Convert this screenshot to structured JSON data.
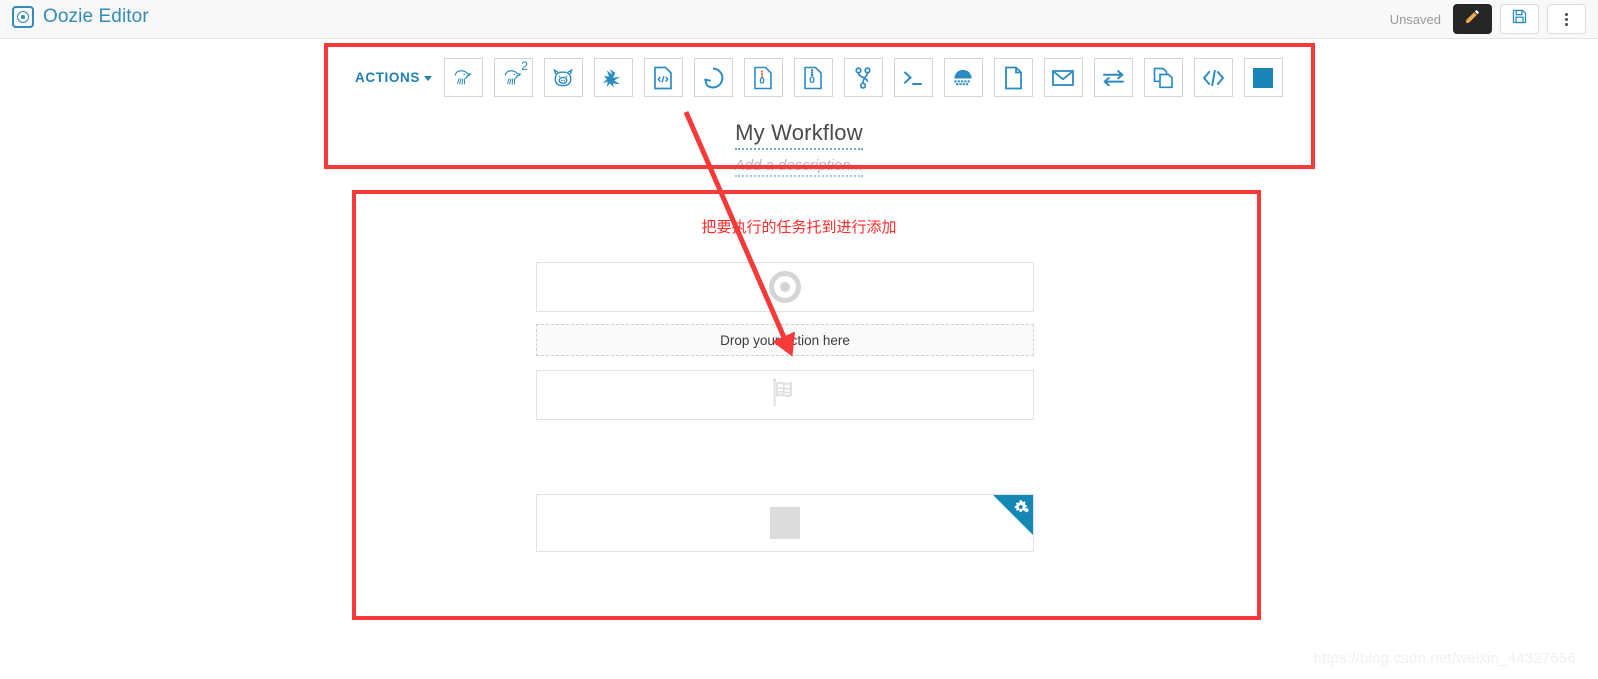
{
  "window": {
    "brand_icon": "oozie-circle-icon",
    "title": "Oozie Editor"
  },
  "topbar": {
    "status_label": "Unsaved",
    "edit_icon": "pencil-icon",
    "save_icon": "floppy-disk-icon",
    "more_icon": "vertical-ellipsis-icon"
  },
  "toolbar": {
    "dropdown_label": "ACTIONS",
    "actions": [
      {
        "name": "hive-action",
        "icon": "hive-elephant-icon",
        "badge": ""
      },
      {
        "name": "hive2-action",
        "icon": "hive-elephant-icon",
        "badge": "2"
      },
      {
        "name": "pig-action",
        "icon": "pig-icon",
        "badge": ""
      },
      {
        "name": "spark-action",
        "icon": "spark-star-icon",
        "badge": ""
      },
      {
        "name": "java-action",
        "icon": "code-document-icon",
        "badge": ""
      },
      {
        "name": "sqoop-action",
        "icon": "sqoop-circle-icon",
        "badge": ""
      },
      {
        "name": "hbase-action",
        "icon": "hbase-document-icon",
        "badge": ""
      },
      {
        "name": "impala-action",
        "icon": "compressed-document-icon",
        "badge": ""
      },
      {
        "name": "git-action",
        "icon": "git-branch-icon",
        "badge": ""
      },
      {
        "name": "shell-action",
        "icon": "terminal-prompt-icon",
        "badge": ""
      },
      {
        "name": "distcp-action",
        "icon": "distcp-arch-icon",
        "badge": ""
      },
      {
        "name": "fs-action",
        "icon": "file-icon",
        "badge": ""
      },
      {
        "name": "email-action",
        "icon": "envelope-icon",
        "badge": ""
      },
      {
        "name": "streaming-action",
        "icon": "transfer-arrows-icon",
        "badge": ""
      },
      {
        "name": "subworkflow-action",
        "icon": "copy-documents-icon",
        "badge": ""
      },
      {
        "name": "generic-action",
        "icon": "code-brackets-icon",
        "badge": ""
      },
      {
        "name": "kill-action",
        "icon": "blue-square-icon",
        "badge": ""
      }
    ]
  },
  "workflow": {
    "name": "My Workflow",
    "description_placeholder": "Add a description...",
    "nodes": {
      "start": {
        "label": "",
        "icon": "start-circle-icon"
      },
      "dropzone": {
        "label": "Drop your action here"
      },
      "end": {
        "label": "",
        "icon": "checkered-flag-icon"
      },
      "kill": {
        "label": "",
        "icon": "kill-square-icon",
        "ribbon_icon": "gears-icon"
      }
    }
  },
  "annotations": {
    "note_text": "把要执行的任务托到进行添加",
    "highlight_color": "#f63a3a"
  },
  "watermark": {
    "text": "https://blog.csdn.net/weixin_44327656"
  }
}
